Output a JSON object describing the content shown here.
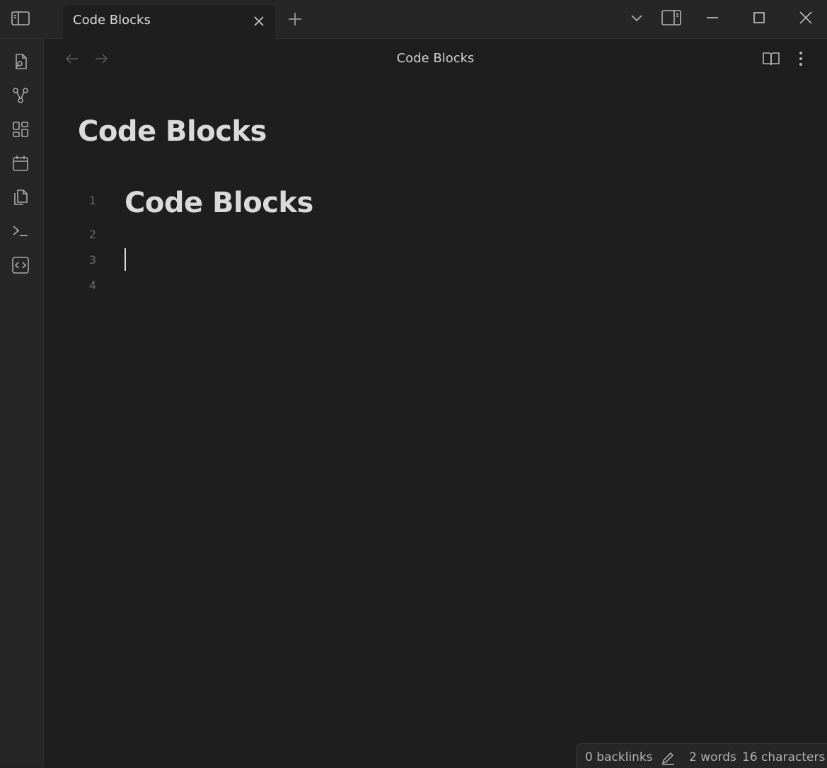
{
  "tab": {
    "title": "Code Blocks"
  },
  "view_header": {
    "title": "Code Blocks"
  },
  "note": {
    "inline_title": "Code Blocks"
  },
  "editor": {
    "lines": [
      {
        "number": "1",
        "text": "Code Blocks"
      },
      {
        "number": "2",
        "text": ""
      },
      {
        "number": "3",
        "text": ""
      },
      {
        "number": "4",
        "text": ""
      }
    ]
  },
  "status": {
    "backlinks": "0 backlinks",
    "words": "2 words",
    "characters": "16 characters"
  },
  "icons": {
    "sidebar_toggle": "sidebar-toggle-icon",
    "tab_close": "close-icon",
    "new_tab": "plus-icon",
    "tab_list": "chevron-down-icon",
    "right_sidebar": "right-sidebar-icon",
    "minimize": "minimize-icon",
    "maximize": "maximize-icon",
    "close_window": "close-icon",
    "ribbon": [
      "file-search-icon",
      "graph-icon",
      "dashboard-icon",
      "calendar-icon",
      "copy-icon",
      "terminal-icon",
      "code-icon"
    ],
    "back": "arrow-left-icon",
    "forward": "arrow-right-icon",
    "reading_view": "book-open-icon",
    "more": "more-vertical-icon",
    "edit": "pencil-icon"
  },
  "colors": {
    "background": "#1e1e1e",
    "chrome": "#262626",
    "text": "#dadada",
    "muted": "#6a6a6a"
  }
}
